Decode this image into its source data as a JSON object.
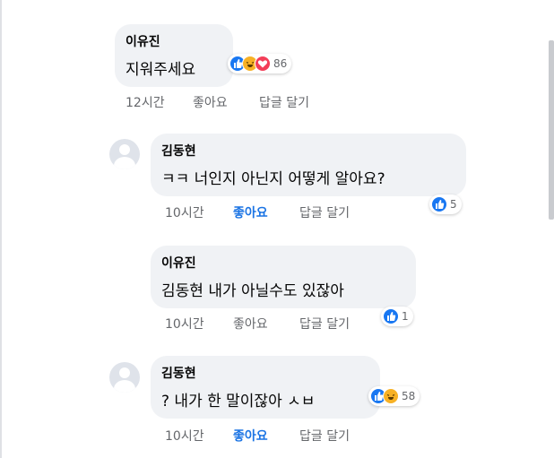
{
  "comments": [
    {
      "author": "이유진",
      "text": "지워주세요",
      "time": "12시간",
      "like_label": "좋아요",
      "reply_label": "답글 달기",
      "reaction_count": "86",
      "reactions": [
        "like",
        "haha",
        "love"
      ],
      "has_avatar": false
    },
    {
      "author": "김동현",
      "text": "ㅋㅋ 너인지 아닌지 어떻게 알아요?",
      "time": "10시간",
      "like_label": "좋아요",
      "reply_label": "답글 달기",
      "reaction_count": "5",
      "reactions": [
        "like"
      ],
      "has_avatar": true,
      "liked": true
    },
    {
      "author": "이유진",
      "text": "김동현  내가 아닐수도 있잖아",
      "time": "10시간",
      "like_label": "좋아요",
      "reply_label": "답글 달기",
      "reaction_count": "1",
      "reactions": [
        "like"
      ],
      "has_avatar": false
    },
    {
      "author": "김동현",
      "text": "? 내가 한 말이잖아 ㅅㅂ",
      "time": "10시간",
      "like_label": "좋아요",
      "reply_label": "답글 달기",
      "reaction_count": "58",
      "reactions": [
        "like",
        "haha"
      ],
      "has_avatar": true,
      "liked": true
    }
  ],
  "colors": {
    "bubble": "#f0f2f5",
    "like_blue": "#1877f2",
    "haha_yellow": "#f7b125",
    "love_red": "#f33e58",
    "meta_gray": "#65676b"
  },
  "icons": [
    "avatar-placeholder-icon",
    "like-reaction-icon",
    "haha-reaction-icon",
    "love-reaction-icon"
  ]
}
